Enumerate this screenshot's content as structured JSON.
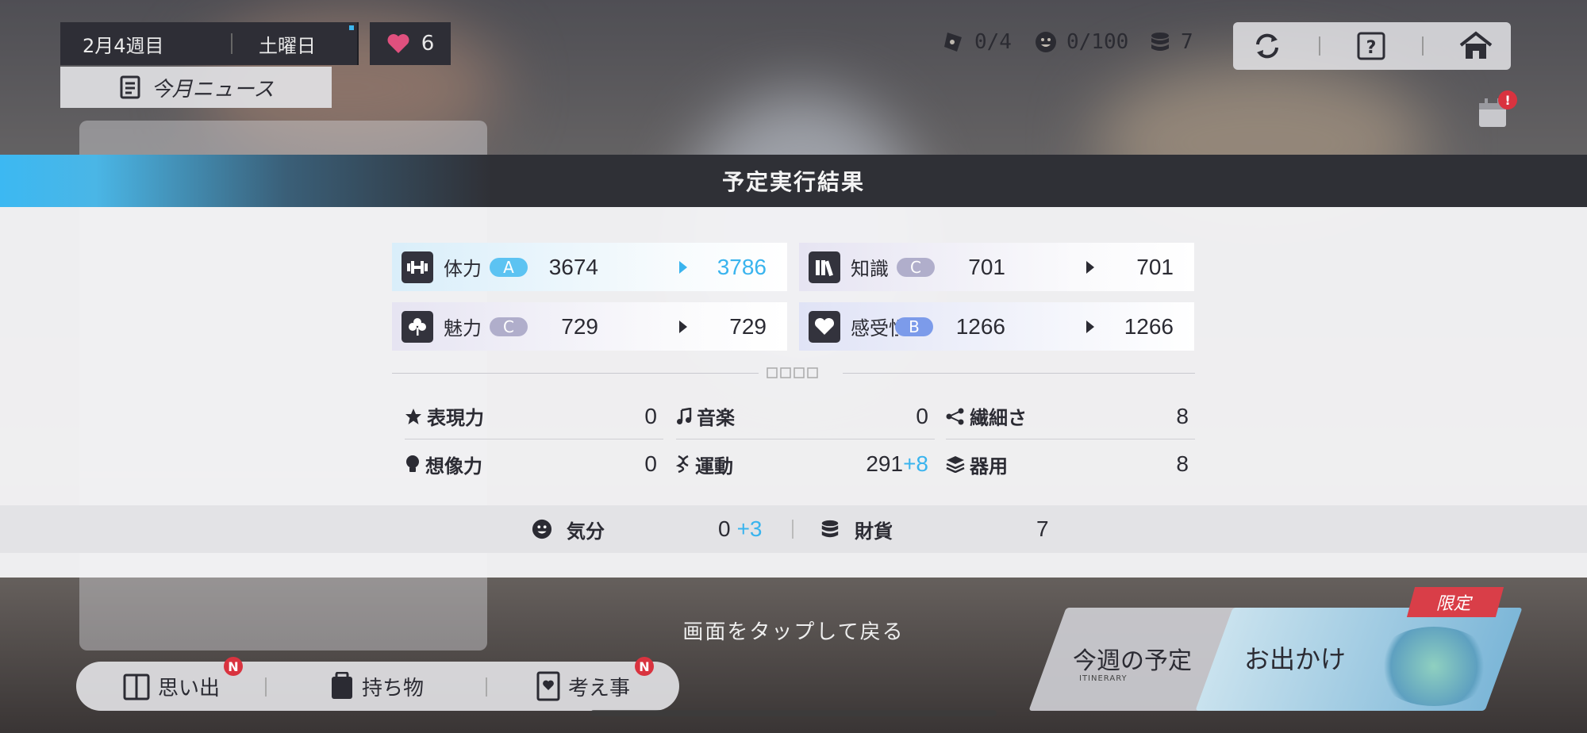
{
  "top": {
    "week": "2月4週目",
    "day": "土曜日",
    "hearts": "6",
    "news": "今月ニュース",
    "tickets": "0/4",
    "mood_count": "0/100",
    "coins": "7"
  },
  "modal": {
    "title": "予定実行結果",
    "main_stats": [
      {
        "name": "体力",
        "grade": "A",
        "from": "3674",
        "to": "3786",
        "increased": true
      },
      {
        "name": "知識",
        "grade": "C",
        "from": "701",
        "to": "701",
        "increased": false
      },
      {
        "name": "魅力",
        "grade": "C",
        "from": "729",
        "to": "729",
        "increased": false
      },
      {
        "name": "感受性",
        "grade": "B",
        "from": "1266",
        "to": "1266",
        "increased": false
      }
    ],
    "sub_stats": [
      {
        "name": "表現力",
        "value": "0",
        "plus": ""
      },
      {
        "name": "音楽",
        "value": "0",
        "plus": ""
      },
      {
        "name": "繊細さ",
        "value": "8",
        "plus": ""
      },
      {
        "name": "想像力",
        "value": "0",
        "plus": ""
      },
      {
        "name": "運動",
        "value": "291",
        "plus": "+8"
      },
      {
        "name": "器用",
        "value": "8",
        "plus": ""
      }
    ],
    "mood": {
      "label": "気分",
      "value": "0",
      "plus": "+3"
    },
    "money": {
      "label": "財貨",
      "value": "7"
    }
  },
  "tap_hint": "画面をタップして戻る",
  "bottom": {
    "memories": "思い出",
    "items": "持ち物",
    "thoughts": "考え事",
    "new_badge": "N",
    "plan": "今週の予定",
    "plan_sub": "ITINERARY",
    "outing": "お出かけ",
    "limited": "限定"
  },
  "colors": {
    "accent": "#3ab4ee",
    "grade_a": "#5cc3f2",
    "grade_b": "#7c9bea",
    "grade_c": "#b0aecb"
  }
}
